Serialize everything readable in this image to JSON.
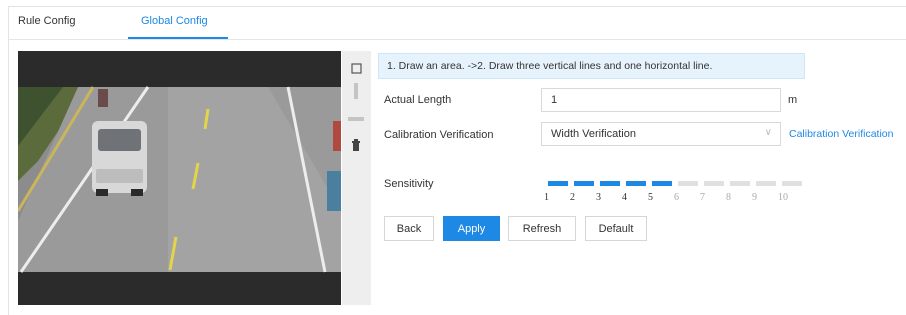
{
  "tabs": [
    {
      "label": "Rule Config",
      "active": false
    },
    {
      "label": "Global Config",
      "active": true
    }
  ],
  "hint": "1. Draw an area. ->2. Draw three vertical lines and one horizontal line.",
  "form": {
    "actual_length": {
      "label": "Actual Length",
      "value": "1",
      "unit": "m"
    },
    "calibration": {
      "label": "Calibration Verification",
      "selected": "Width Verification",
      "link": "Calibration Verification"
    },
    "sensitivity": {
      "label": "Sensitivity",
      "value": 5,
      "max": 10,
      "ticks": [
        "1",
        "2",
        "3",
        "4",
        "5",
        "6",
        "7",
        "8",
        "9",
        "10"
      ]
    }
  },
  "buttons": {
    "back": "Back",
    "apply": "Apply",
    "refresh": "Refresh",
    "default": "Default"
  },
  "icons": {
    "tool_1": "draw-rectangle-icon",
    "tool_2": "vertical-line-icon",
    "tool_3": "horizontal-line-icon",
    "tool_4": "delete-icon"
  },
  "colors": {
    "accent": "#1e88e5",
    "inactive_segment": "#e0e0e0",
    "hint_bg": "#e6f3fd"
  }
}
